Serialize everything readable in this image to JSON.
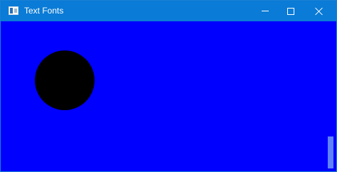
{
  "window": {
    "title": "Text Fonts",
    "icon": "app-window-icon",
    "controls": [
      "minimize-icon",
      "maximize-icon",
      "close-icon"
    ]
  },
  "canvas": {
    "background_color": "#0000ff",
    "shape": {
      "type": "circle",
      "fill_color": "#000000"
    }
  },
  "colors": {
    "titlebar": "#0a7bd6",
    "title_text": "#ffffff"
  }
}
